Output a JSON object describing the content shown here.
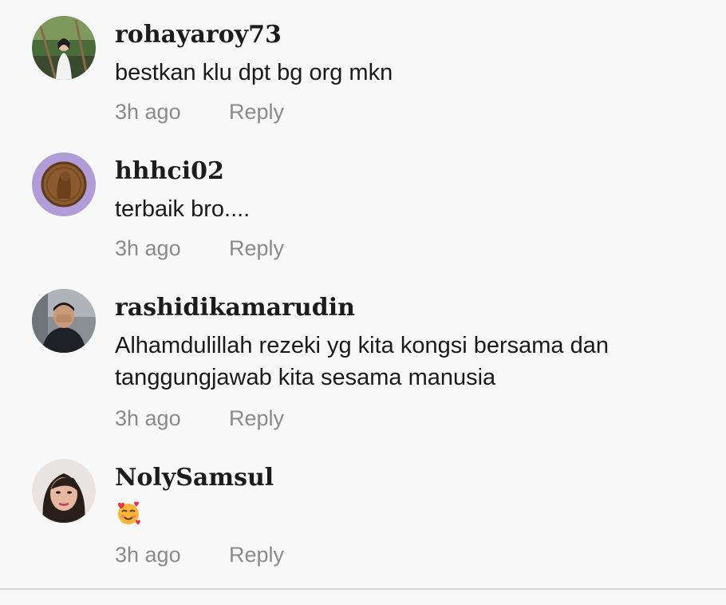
{
  "comments": [
    {
      "username": "rohayaroy73",
      "text": "bestkan klu dpt bg org mkn",
      "time": "3h ago",
      "reply_label": "Reply"
    },
    {
      "username": "hhhci02",
      "text": "terbaik bro....",
      "time": "3h ago",
      "reply_label": "Reply"
    },
    {
      "username": "rashidikamarudin",
      "text": "Alhamdulillah rezeki yg kita kongsi bersama dan tanggungjawab kita sesama manusia",
      "time": "3h ago",
      "reply_label": "Reply"
    },
    {
      "username": "NolySamsul",
      "text": "",
      "emoji": "smiling-face-with-hearts",
      "time": "3h ago",
      "reply_label": "Reply"
    }
  ],
  "colors": {
    "background": "#f8f8f8",
    "username": "#1c1c1c",
    "text": "#1a1a1a",
    "meta": "#8a8a8a",
    "divider": "#d6d6d6"
  }
}
